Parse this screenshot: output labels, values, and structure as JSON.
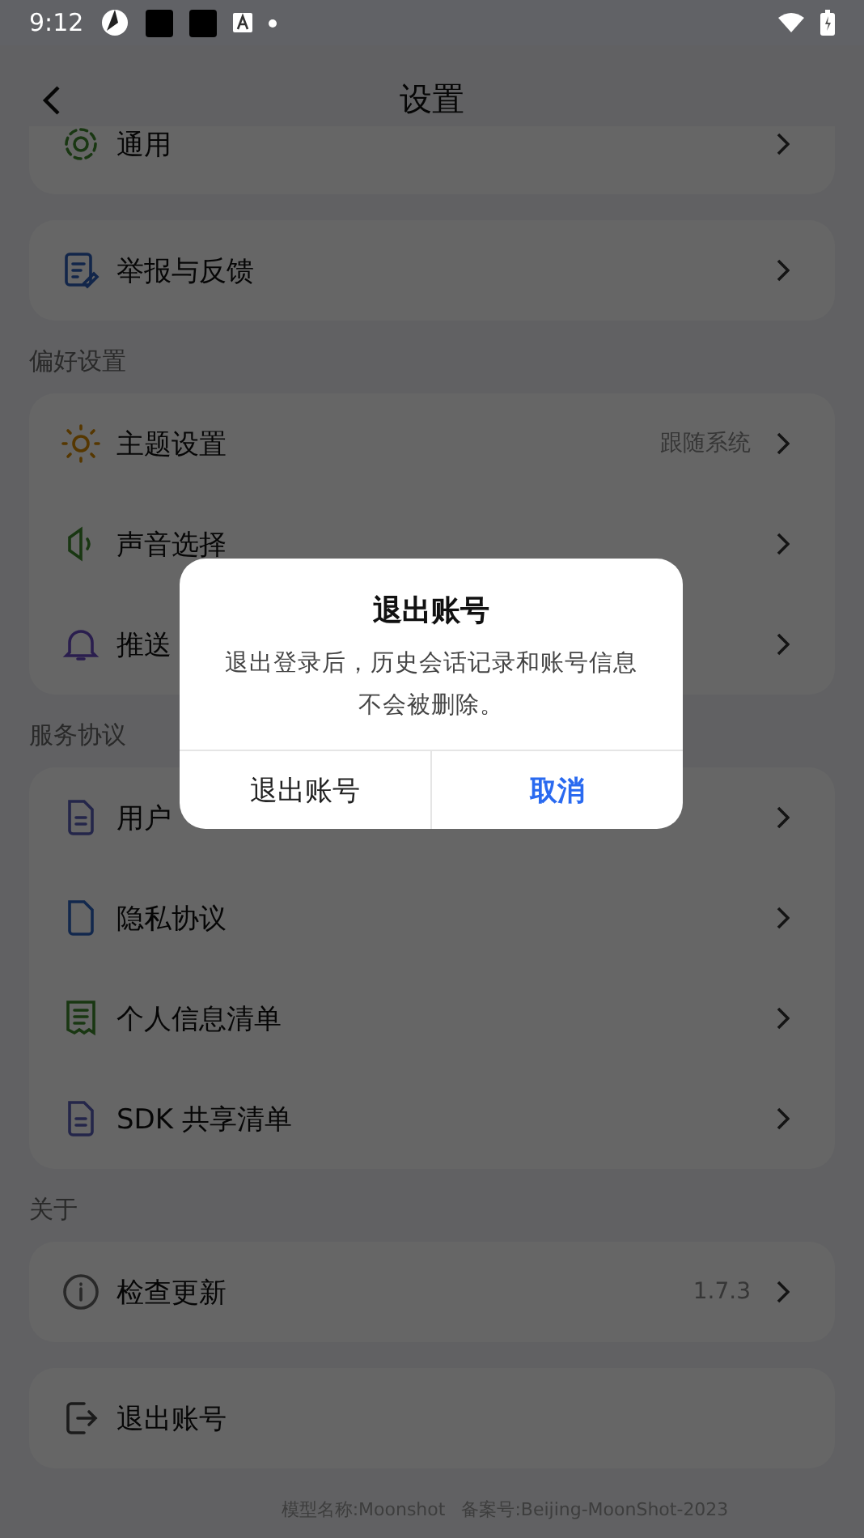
{
  "status_bar": {
    "time": "9:12"
  },
  "header": {
    "title": "设置"
  },
  "sections": [
    {
      "cards": [
        {
          "rows": [
            {
              "label": "通用"
            }
          ]
        },
        {
          "rows": [
            {
              "label": "举报与反馈"
            }
          ]
        }
      ]
    },
    {
      "heading": "偏好设置",
      "cards": [
        {
          "rows": [
            {
              "label": "主题设置",
              "value": "跟随系统"
            },
            {
              "label": "声音选择"
            },
            {
              "label": "推送"
            }
          ]
        }
      ]
    },
    {
      "heading": "服务协议",
      "cards": [
        {
          "rows": [
            {
              "label": "用户"
            },
            {
              "label": "隐私协议"
            },
            {
              "label": "个人信息清单"
            },
            {
              "label": "SDK 共享清单"
            }
          ]
        }
      ]
    },
    {
      "heading": "关于",
      "cards": [
        {
          "rows": [
            {
              "label": "检查更新",
              "value": "1.7.3"
            }
          ]
        },
        {
          "rows": [
            {
              "label": "退出账号",
              "chevron": false
            }
          ]
        }
      ]
    }
  ],
  "footer": {
    "model": "模型名称:Moonshot",
    "record": "备案号:Beijing-MoonShot-2023"
  },
  "dialog": {
    "title": "退出账号",
    "message": "退出登录后，历史会话记录和账号信息不会被删除。",
    "buttons": [
      {
        "label": "退出账号",
        "primary": false
      },
      {
        "label": "取消",
        "primary": true
      }
    ]
  }
}
